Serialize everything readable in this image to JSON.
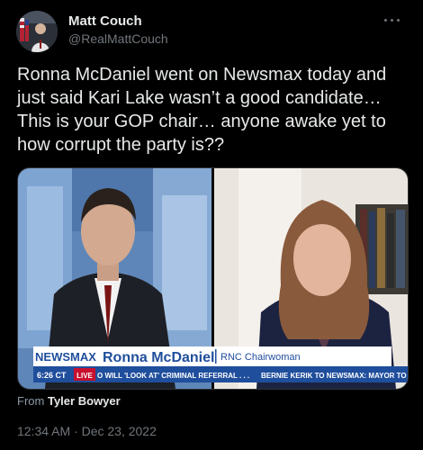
{
  "author": {
    "name": "Matt Couch",
    "handle": "@RealMattCouch"
  },
  "tweet": {
    "text": "Ronna McDaniel went on Newsmax today and just said Kari Lake wasn’t a good candidate… This is your GOP chair… anyone awake yet to how corrupt the party is??"
  },
  "media": {
    "network_logo": "NEWSMAX",
    "guest_name": "Ronna McDaniel",
    "guest_title": "RNC Chairwoman",
    "time": "6:26 CT",
    "live_label": "LIVE",
    "ticker_left": "O WILL 'LOOK AT' CRIMINAL REFERRAL . . .",
    "ticker_right": "BERNIE KERIK TO NEWSMAX: MAYOR TO E"
  },
  "attribution": {
    "prefix": "From",
    "source": "Tyler Bowyer"
  },
  "meta": {
    "timestamp": "12:34 AM · Dec 23, 2022"
  },
  "colors": {
    "background": "#000000",
    "text_primary": "#e7e9ea",
    "text_secondary": "#71767b",
    "newsmax_blue": "#1f4e9c",
    "live_red": "#c8102e"
  }
}
